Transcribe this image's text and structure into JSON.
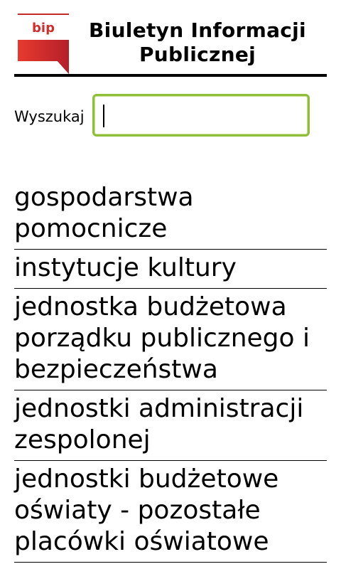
{
  "header": {
    "logo_text": "bip",
    "title_line1": "Biuletyn Informacji",
    "title_line2": "Publicznej"
  },
  "search": {
    "label": "Wyszukaj",
    "value": ""
  },
  "categories": [
    "gospodarstwa pomocnicze",
    "instytucje kultury",
    "jednostka budżetowa porządku publicznego i bezpieczeństwa",
    "jednostki administracji zespolonej",
    "jednostki budżetowe oświaty - pozostałe placówki oświatowe"
  ],
  "colors": {
    "logo_red": "#d42b2b",
    "search_border": "#8fbf3a"
  }
}
